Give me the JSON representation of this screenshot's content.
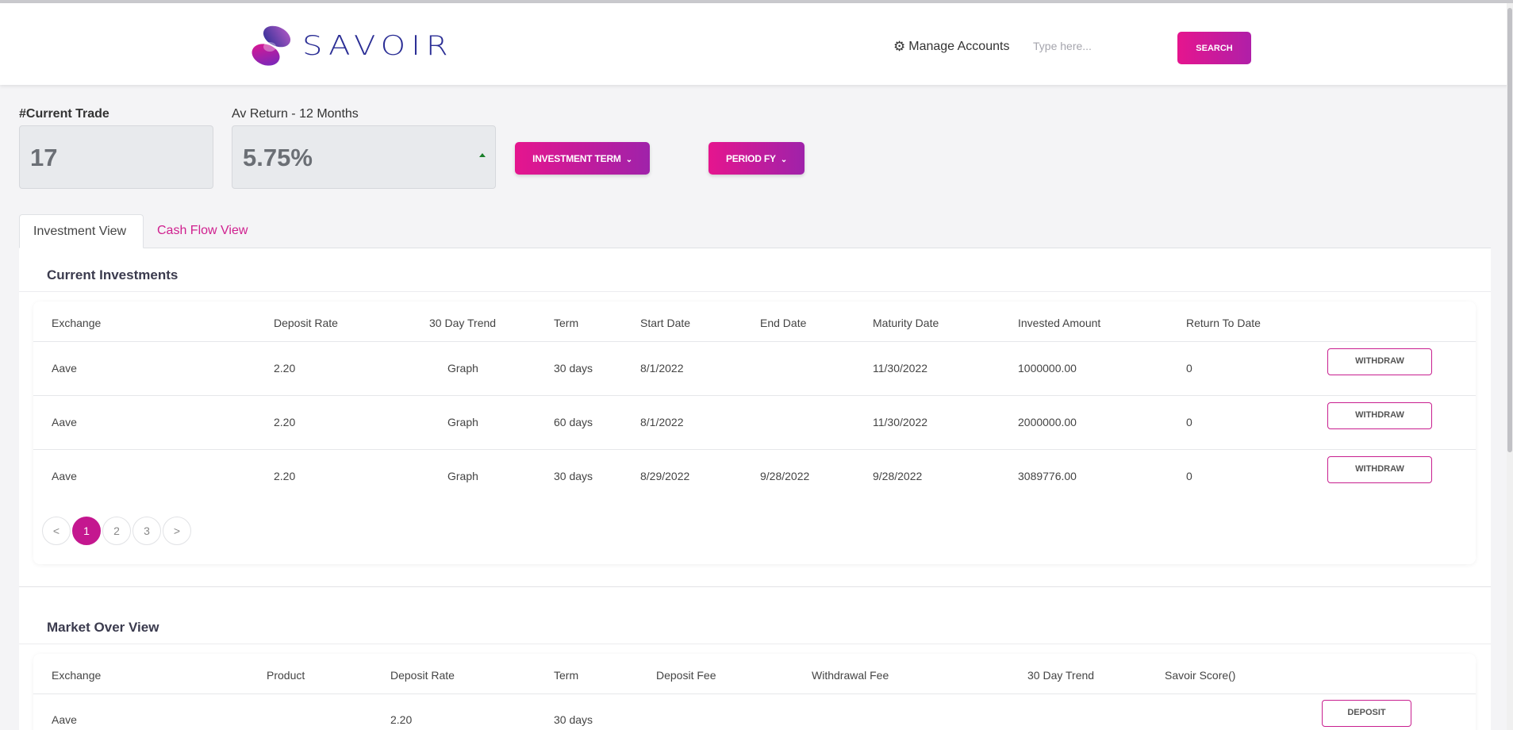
{
  "header": {
    "logo_text": "SAVOIR",
    "manage_accounts": "Manage Accounts",
    "search_placeholder": "Type here...",
    "search_button": "SEARCH"
  },
  "stats": {
    "current_trade_label": "#Current Trade",
    "current_trade_value": "17",
    "av_return_label": "Av Return - 12 Months",
    "av_return_value": "5.75%"
  },
  "filters": {
    "investment_term": "INVESTMENT TERM",
    "period": "PERIOD FY"
  },
  "tabs": [
    {
      "label": "Investment View",
      "active": true
    },
    {
      "label": "Cash Flow View",
      "active": false
    }
  ],
  "current_investments": {
    "title": "Current Investments",
    "columns": [
      "Exchange",
      "Deposit Rate",
      "30 Day Trend",
      "Term",
      "Start Date",
      "End Date",
      "Maturity Date",
      "Invested Amount",
      "Return To Date"
    ],
    "rows": [
      {
        "exchange": "Aave",
        "deposit_rate": "2.20",
        "trend": "Graph",
        "term": "30 days",
        "start": "8/1/2022",
        "end": "",
        "maturity": "11/30/2022",
        "amount": "1000000.00",
        "return": "0",
        "action": "WITHDRAW"
      },
      {
        "exchange": "Aave",
        "deposit_rate": "2.20",
        "trend": "Graph",
        "term": "60 days",
        "start": "8/1/2022",
        "end": "",
        "maturity": "11/30/2022",
        "amount": "2000000.00",
        "return": "0",
        "action": "WITHDRAW"
      },
      {
        "exchange": "Aave",
        "deposit_rate": "2.20",
        "trend": "Graph",
        "term": "30 days",
        "start": "8/29/2022",
        "end": "9/28/2022",
        "maturity": "9/28/2022",
        "amount": "3089776.00",
        "return": "0",
        "action": "WITHDRAW"
      }
    ],
    "pagination": {
      "prev": "<",
      "pages": [
        "1",
        "2",
        "3"
      ],
      "next": ">",
      "current": "1"
    }
  },
  "market_overview": {
    "title": "Market Over View",
    "columns": [
      "Exchange",
      "Product",
      "Deposit Rate",
      "Term",
      "Deposit Fee",
      "Withdrawal Fee",
      "30 Day Trend",
      "Savoir Score()"
    ],
    "rows": [
      {
        "exchange": "Aave",
        "product": "",
        "deposit_rate": "2.20",
        "term": "30 days",
        "deposit_fee": "",
        "withdrawal_fee": "",
        "trend": "",
        "score": "",
        "action": "DEPOSIT"
      }
    ]
  },
  "colors": {
    "accent": "#e5158e",
    "accent_dark": "#a020aa",
    "brand_text": "#2b2e95",
    "trend_up": "#1a7f2a"
  }
}
